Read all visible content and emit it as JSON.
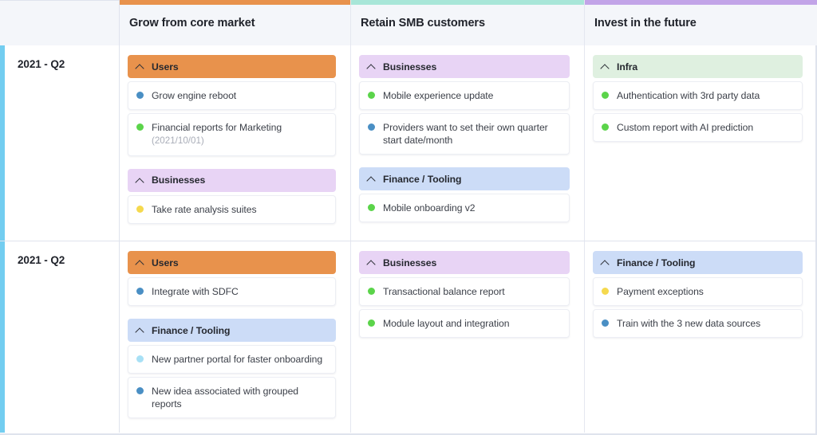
{
  "board": {
    "row_stripe_color": "#73cdf0",
    "columns": [
      {
        "title": "Grow from core market",
        "accent_color": "#e8924c"
      },
      {
        "title": "Retain SMB customers",
        "accent_color": "#a8e6d8"
      },
      {
        "title": "Invest in the future",
        "accent_color": "#c2a4e8"
      }
    ],
    "group_colors": {
      "Users": "#e8924c",
      "Businesses": "#e8d4f5",
      "Finance / Tooling": "#ccdcf7",
      "Infra": "#dff0e0"
    },
    "dot_colors": {
      "blue": "#4a8fc4",
      "green": "#5bd44a",
      "yellow": "#f5d94e",
      "light_blue": "#a8e0f5"
    },
    "chevron_icon": "chevron-up-icon",
    "rows": [
      {
        "quarter": "2021 - Q2",
        "lanes": [
          {
            "groups": [
              {
                "name": "Users",
                "header_color": "#e8924c",
                "items": [
                  {
                    "label": "Grow engine reboot",
                    "date": "",
                    "dot": "#4a8fc4"
                  },
                  {
                    "label": "Financial reports for Marketing",
                    "date": "(2021/10/01)",
                    "dot": "#5bd44a"
                  }
                ]
              },
              {
                "name": "Businesses",
                "header_color": "#e8d4f5",
                "items": [
                  {
                    "label": "Take rate analysis suites",
                    "date": "",
                    "dot": "#f5d94e"
                  }
                ]
              }
            ]
          },
          {
            "groups": [
              {
                "name": "Businesses",
                "header_color": "#e8d4f5",
                "items": [
                  {
                    "label": "Mobile experience update",
                    "date": "",
                    "dot": "#5bd44a"
                  },
                  {
                    "label": "Providers want to set their own quarter start date/month",
                    "date": "",
                    "dot": "#4a8fc4"
                  }
                ]
              },
              {
                "name": "Finance / Tooling",
                "header_color": "#ccdcf7",
                "items": [
                  {
                    "label": "Mobile onboarding v2",
                    "date": "",
                    "dot": "#5bd44a"
                  }
                ]
              }
            ]
          },
          {
            "groups": [
              {
                "name": "Infra",
                "header_color": "#dff0e0",
                "items": [
                  {
                    "label": "Authentication with 3rd party data",
                    "date": "",
                    "dot": "#5bd44a"
                  },
                  {
                    "label": "Custom report with AI prediction",
                    "date": "",
                    "dot": "#5bd44a"
                  }
                ]
              }
            ]
          }
        ]
      },
      {
        "quarter": "2021 - Q2",
        "lanes": [
          {
            "groups": [
              {
                "name": "Users",
                "header_color": "#e8924c",
                "items": [
                  {
                    "label": "Integrate with SDFC",
                    "date": "",
                    "dot": "#4a8fc4"
                  }
                ]
              },
              {
                "name": "Finance / Tooling",
                "header_color": "#ccdcf7",
                "items": [
                  {
                    "label": "New partner portal for faster onboarding",
                    "date": "",
                    "dot": "#a8e0f5"
                  },
                  {
                    "label": "New idea associated with grouped reports",
                    "date": "",
                    "dot": "#4a8fc4"
                  }
                ]
              }
            ]
          },
          {
            "groups": [
              {
                "name": "Businesses",
                "header_color": "#e8d4f5",
                "items": [
                  {
                    "label": "Transactional balance report",
                    "date": "",
                    "dot": "#5bd44a"
                  },
                  {
                    "label": "Module layout and integration",
                    "date": "",
                    "dot": "#5bd44a"
                  }
                ]
              }
            ]
          },
          {
            "groups": [
              {
                "name": "Finance / Tooling",
                "header_color": "#ccdcf7",
                "items": [
                  {
                    "label": "Payment exceptions",
                    "date": "",
                    "dot": "#f5d94e"
                  },
                  {
                    "label": "Train with the 3 new data sources",
                    "date": "",
                    "dot": "#4a8fc4"
                  }
                ]
              }
            ]
          }
        ]
      }
    ]
  }
}
